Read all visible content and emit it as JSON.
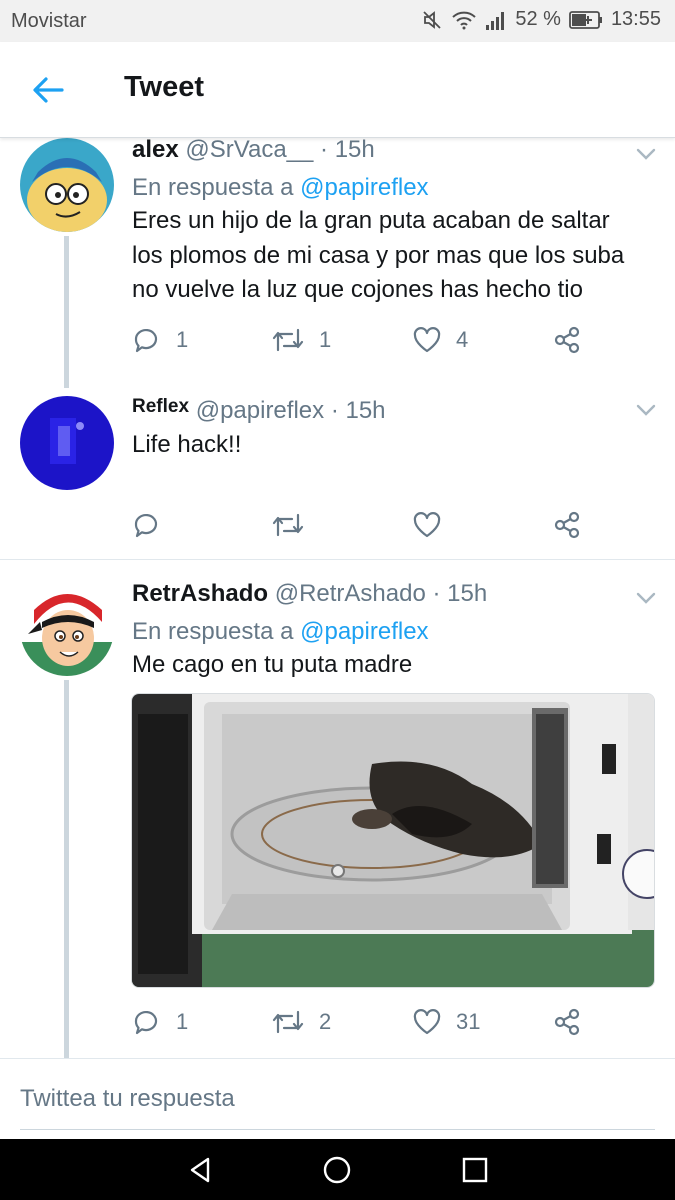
{
  "status_bar": {
    "carrier": "Movistar",
    "battery_percent": "52 %",
    "time": "13:55",
    "icons": [
      "mute-icon",
      "wifi-icon",
      "signal-icon",
      "battery-icon"
    ]
  },
  "header": {
    "title": "Tweet",
    "back_icon": "arrow-left-icon"
  },
  "tweets": [
    {
      "name": "alex",
      "handle": "@SrVaca__",
      "time": "· 15h",
      "reply_prefix": "En respuesta a",
      "reply_to": "@papireflex",
      "text_lines": [
        "Eres un hijo de la gran puta acaban de saltar",
        "los plomos de mi casa y por mas que los suba",
        "no vuelve la luz que cojones has hecho tio"
      ],
      "replies": "1",
      "retweets": "1",
      "likes": "4"
    },
    {
      "name": "Reflex",
      "handle": "@papireflex",
      "time": "· 15h",
      "text_lines": [
        "Life hack!!"
      ],
      "replies": "",
      "retweets": "",
      "likes": ""
    },
    {
      "name": "RetrAshado",
      "handle": "@RetrAshado",
      "time": "· 15h",
      "reply_prefix": "En respuesta a",
      "reply_to": "@papireflex",
      "text_lines": [
        "Me cago en tu puta madre"
      ],
      "replies": "1",
      "retweets": "2",
      "likes": "31"
    }
  ],
  "reply_box": {
    "placeholder": "Twittea tu respuesta"
  },
  "nav": {
    "icons": [
      "back-triangle-icon",
      "home-circle-icon",
      "recents-square-icon"
    ]
  },
  "colors": {
    "accent": "#1da1f2",
    "secondary_text": "#657786",
    "primary_text": "#14171a",
    "thread_line": "#ccd6dd"
  }
}
